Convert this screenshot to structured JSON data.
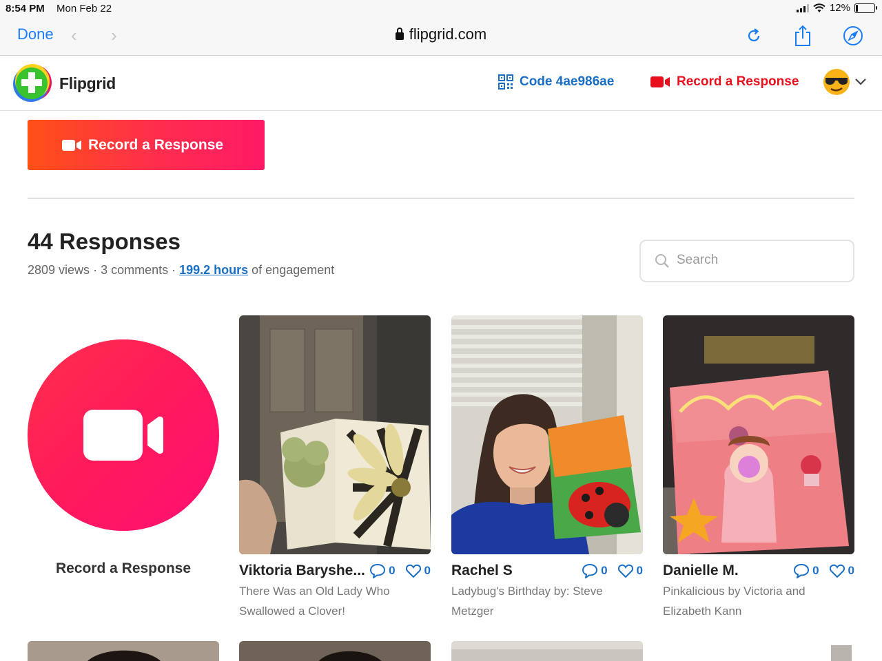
{
  "status_bar": {
    "time": "8:54 PM",
    "date": "Mon Feb 22",
    "battery": "12%"
  },
  "browser": {
    "done_label": "Done",
    "url": "flipgrid.com"
  },
  "header": {
    "brand": "Flipgrid",
    "code_label": "Code 4ae986ae",
    "record_label": "Record a Response"
  },
  "main": {
    "record_button_label": "Record a Response",
    "responses_title": "44 Responses",
    "stats": {
      "views": "2809 views",
      "sep1": " · ",
      "comments": "3 comments",
      "sep2": " · ",
      "hours": "199.2 hours",
      "engagement": " of engagement"
    },
    "search_placeholder": "Search",
    "big_record_label": "Record a Response",
    "cards": [
      {
        "name": "Viktoria Baryshe...",
        "comments": "0",
        "likes": "0",
        "description": "There Was an Old Lady Who Swallowed a Clover!"
      },
      {
        "name": "Rachel S",
        "comments": "0",
        "likes": "0",
        "description": "Ladybug's Birthday by: Steve Metzger"
      },
      {
        "name": "Danielle M.",
        "comments": "0",
        "likes": "0",
        "description": "Pinkalicious by Victoria and Elizabeth Kann"
      }
    ]
  },
  "colors": {
    "accent_blue": "#1a6fc5",
    "record_red": "#e8101d",
    "ios_blue": "#1a7cf5"
  }
}
